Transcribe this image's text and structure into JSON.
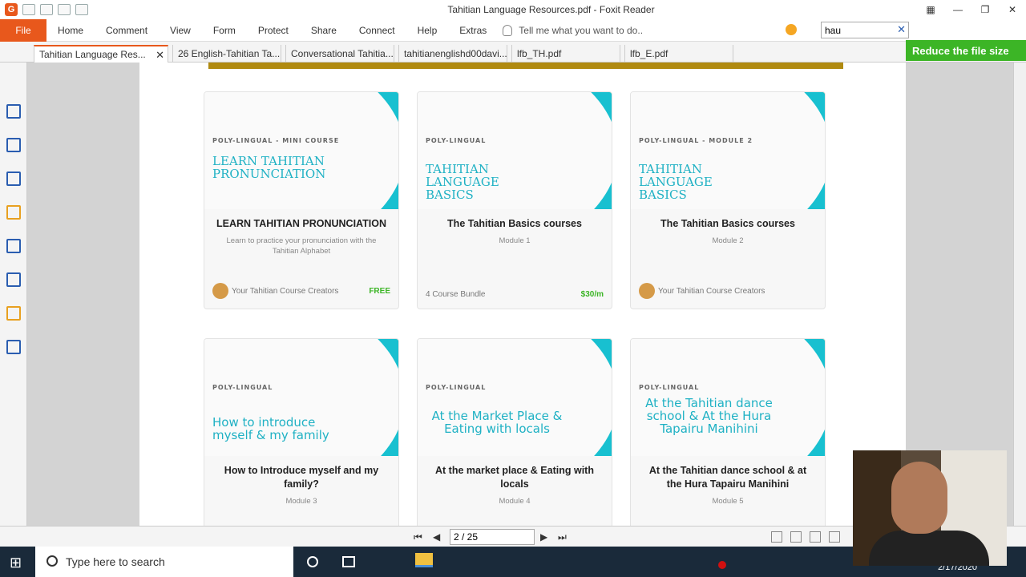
{
  "window": {
    "title": "Tahitian Language Resources.pdf - Foxit Reader"
  },
  "menu": {
    "file": "File",
    "items": [
      "Home",
      "Comment",
      "View",
      "Form",
      "Protect",
      "Share",
      "Connect",
      "Help",
      "Extras"
    ],
    "tell_me": "Tell me what you want to do..",
    "search_value": "hau"
  },
  "tabs": [
    {
      "label": "Tahitian Language Res...",
      "active": true
    },
    {
      "label": "26 English-Tahitian Ta...",
      "active": false
    },
    {
      "label": "Conversational Tahitia...",
      "active": false
    },
    {
      "label": "tahitianenglishd00davi...",
      "active": false
    },
    {
      "label": "lfb_TH.pdf",
      "active": false
    },
    {
      "label": "lfb_E.pdf",
      "active": false
    }
  ],
  "reduce_button": "Reduce the file size",
  "cards": [
    {
      "tag": "POLY-LINGUAL - MINI COURSE",
      "img_title": "LEARN TAHITIAN PRONUNCIATION",
      "title": "LEARN TAHITIAN PRONUNCIATION",
      "sub": "Learn to practice your pronunciation with the Tahitian Alphabet",
      "footer": "Your Tahitian Course Creators",
      "price": "FREE"
    },
    {
      "tag": "POLY-LINGUAL",
      "img_title": "TAHITIAN LANGUAGE BASICS",
      "title": "The Tahitian Basics courses",
      "sub": "Module 1",
      "footer": "4 Course Bundle",
      "price": "$30/m"
    },
    {
      "tag": "POLY-LINGUAL - MODULE 2",
      "img_title": "TAHITIAN LANGUAGE BASICS",
      "title": "The Tahitian Basics courses",
      "sub": "Module 2",
      "footer": "Your Tahitian Course Creators",
      "price": ""
    },
    {
      "tag": "POLY-LINGUAL",
      "img_title": "How to introduce myself & my family",
      "title": "How to Introduce myself and my family?",
      "sub": "Module 3"
    },
    {
      "tag": "POLY-LINGUAL",
      "img_title": "At the Market Place & Eating with locals",
      "title": "At the market place & Eating with locals",
      "sub": "Module 4"
    },
    {
      "tag": "POLY-LINGUAL",
      "img_title": "At the Tahitian dance school & At the Hura Tapairu Manihini",
      "title": "At the Tahitian dance school & at the Hura Tapairu Manihini",
      "sub": "Module 5"
    }
  ],
  "status": {
    "page": "2 / 25"
  },
  "taskbar": {
    "search_placeholder": "Type here to search",
    "date": "2/17/2020"
  }
}
